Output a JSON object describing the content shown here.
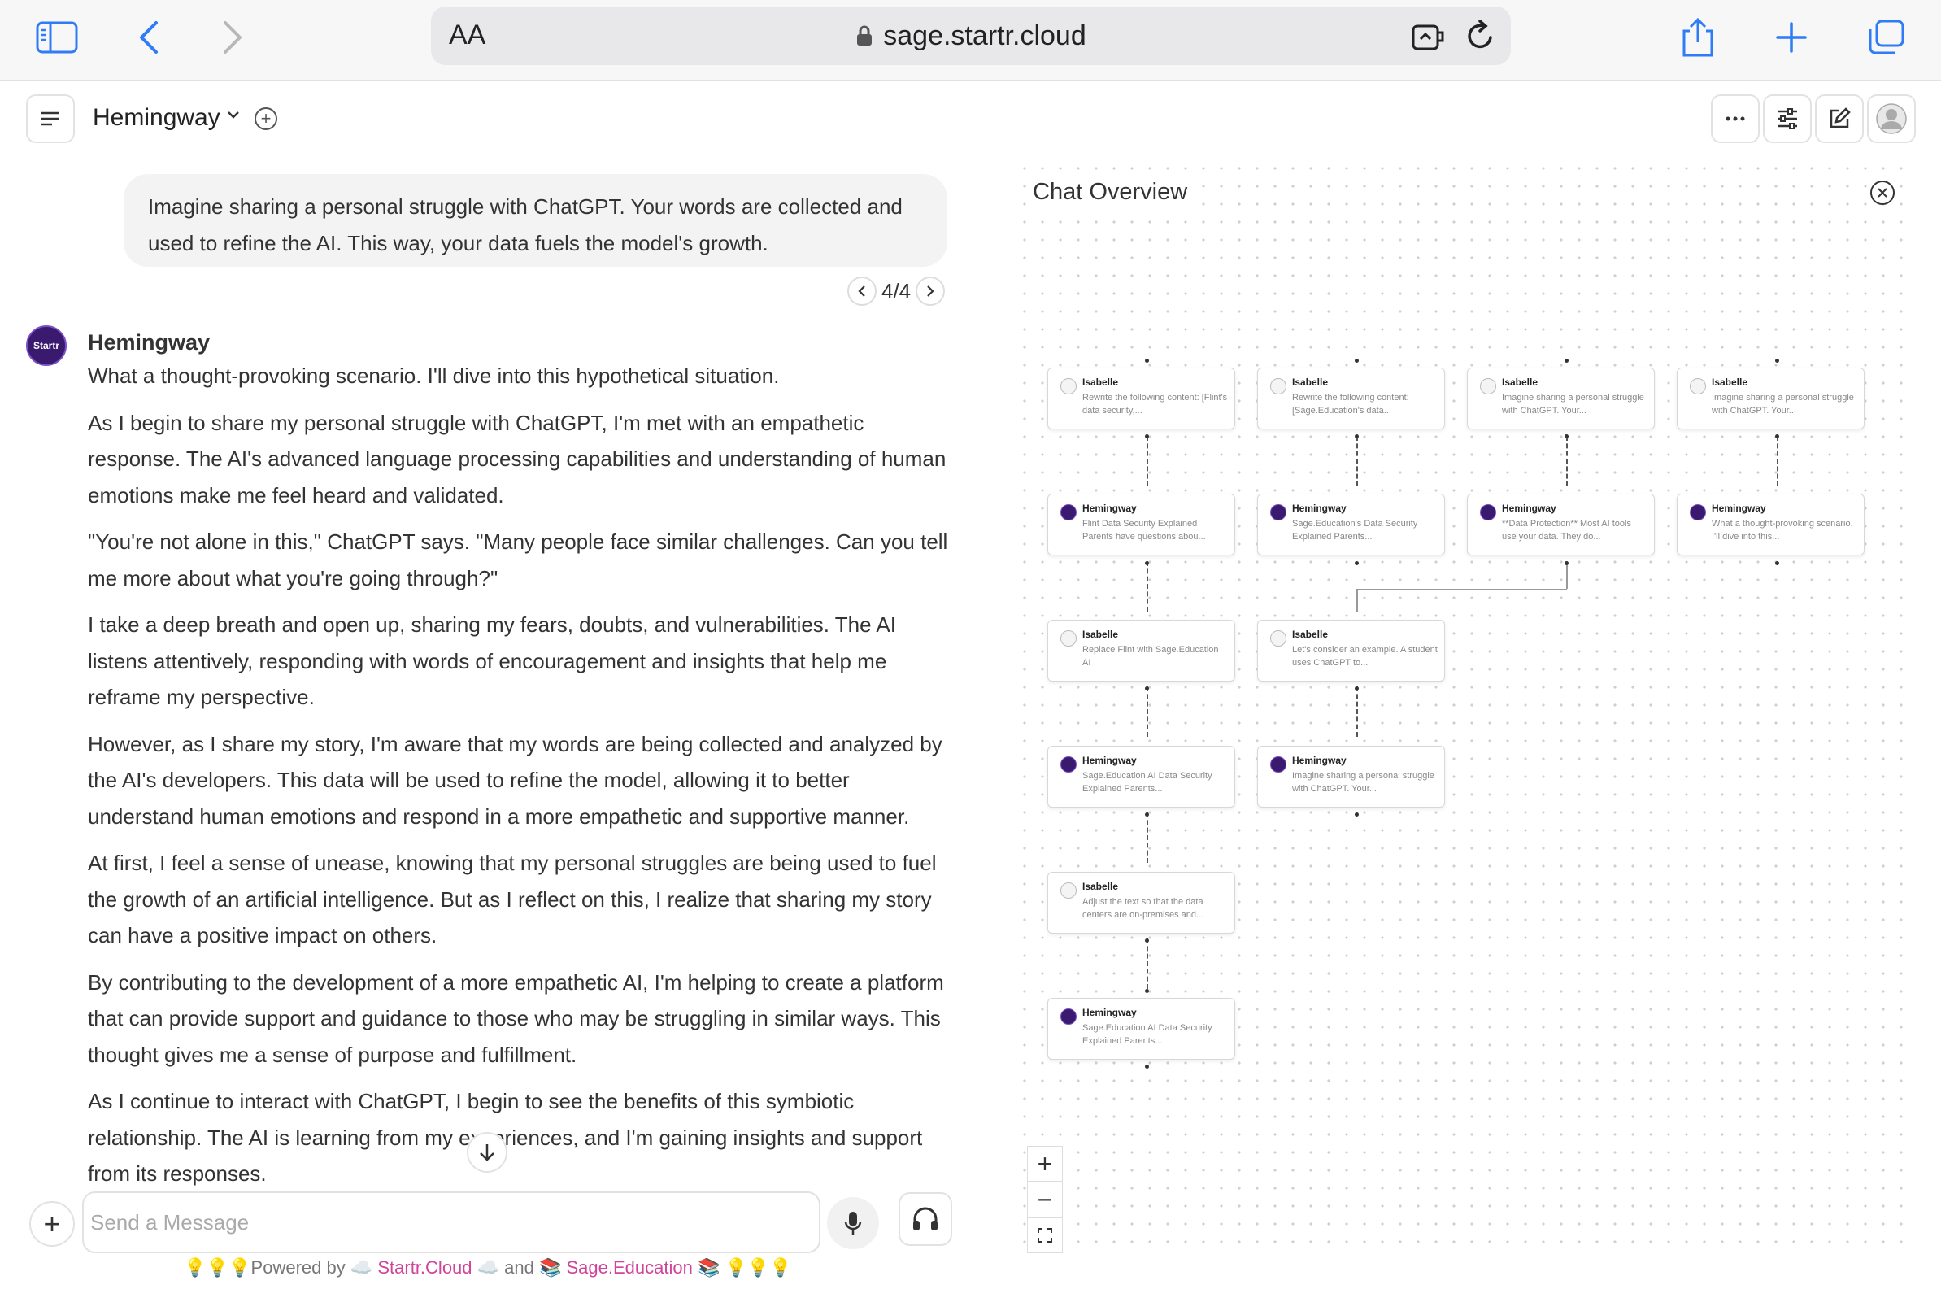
{
  "browser": {
    "aa_label": "AA",
    "url": "sage.startr.cloud"
  },
  "header": {
    "model_name": "Hemingway"
  },
  "chat": {
    "user_message": "Imagine sharing a personal struggle with ChatGPT. Your words are collected and used to refine the AI. This way, your data fuels the model's growth.",
    "pager": "4/4",
    "assistant_name": "Hemingway",
    "avatar_label": "Startr",
    "paragraphs": [
      "What a thought-provoking scenario. I'll dive into this hypothetical situation.",
      "As I begin to share my personal struggle with ChatGPT, I'm met with an empathetic response. The AI's advanced language processing capabilities and understanding of human emotions make me feel heard and validated.",
      "\"You're not alone in this,\" ChatGPT says. \"Many people face similar challenges. Can you tell me more about what you're going through?\"",
      "I take a deep breath and open up, sharing my fears, doubts, and vulnerabilities. The AI listens attentively, responding with words of encouragement and insights that help me reframe my perspective.",
      "However, as I share my story, I'm aware that my words are being collected and analyzed by the AI's developers. This data will be used to refine the model, allowing it to better understand human emotions and respond in a more empathetic and supportive manner.",
      "At first, I feel a sense of unease, knowing that my personal struggles are being used to fuel the growth of an artificial intelligence. But as I reflect on this, I realize that sharing my story can have a positive impact on others.",
      "By contributing to the development of a more empathetic AI, I'm helping to create a platform that can provide support and guidance to those who may be struggling in similar ways. This thought gives me a sense of purpose and fulfillment.",
      "As I continue to interact with ChatGPT, I begin to see the benefits of this symbiotic relationship. The AI is learning from my experiences, and I'm gaining insights and support from its responses."
    ]
  },
  "input": {
    "placeholder": "Send a Message"
  },
  "footer": {
    "prefix": "💡💡💡Powered by ☁️ ",
    "startr": "Startr.Cloud",
    "mid": " ☁️  and  📚 ",
    "sage": "Sage.Education",
    "suffix": " 📚  💡💡💡"
  },
  "overview": {
    "title": "Chat Overview",
    "nodes": [
      {
        "name": "Isabelle",
        "text": "Rewrite the following content: [Flint's data security,..."
      },
      {
        "name": "Isabelle",
        "text": "Rewrite the following content: [Sage.Education's data..."
      },
      {
        "name": "Isabelle",
        "text": "Imagine sharing a personal struggle with ChatGPT. Your..."
      },
      {
        "name": "Isabelle",
        "text": "Imagine sharing a personal struggle with ChatGPT. Your..."
      },
      {
        "name": "Hemingway",
        "text": "Flint Data Security Explained Parents have questions abou..."
      },
      {
        "name": "Hemingway",
        "text": "Sage.Education's Data Security Explained Parents..."
      },
      {
        "name": "Hemingway",
        "text": "**Data Protection** Most AI tools use your data. They do..."
      },
      {
        "name": "Hemingway",
        "text": "What a thought-provoking scenario. I'll dive into this..."
      },
      {
        "name": "Isabelle",
        "text": "Replace Flint with Sage.Education AI"
      },
      {
        "name": "Isabelle",
        "text": "Let's consider an example. A student uses ChatGPT to..."
      },
      {
        "name": "Hemingway",
        "text": "Sage.Education AI Data Security Explained Parents..."
      },
      {
        "name": "Hemingway",
        "text": "Imagine sharing a personal struggle with ChatGPT. Your..."
      },
      {
        "name": "Isabelle",
        "text": "Adjust the text so that the data centers are on-premises and..."
      },
      {
        "name": "Hemingway",
        "text": "Sage.Education AI Data Security Explained Parents..."
      }
    ]
  }
}
